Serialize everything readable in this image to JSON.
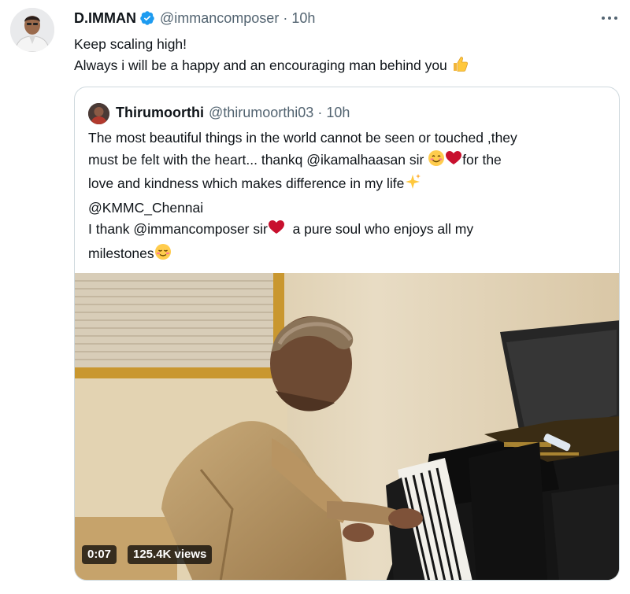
{
  "tweet": {
    "author_name": "D.IMMAN",
    "author_handle": "@immancomposer",
    "separator": "·",
    "time": "10h",
    "lines": [
      "Keep scaling high!",
      "Always i will be a happy and an encouraging man behind you"
    ],
    "icons": {
      "verified": "verified-badge-icon",
      "more": "more-options-icon",
      "thumbs_up": "thumbs-up-emoji"
    }
  },
  "quoted": {
    "author_name": "Thirumoorthi",
    "author_handle": "@thirumoorthi03",
    "separator": "·",
    "time": "10h",
    "text": {
      "l1": "The most beautiful things in the world cannot be seen or touched ,they",
      "l2a": "must be felt with the heart... thankq @ikamalhaasan sir ",
      "l2b": "for the",
      "l3": "love and kindness which makes difference in my life",
      "l4": "@KMMC_Chennai",
      "l5a": "I thank @immancomposer sir",
      "l5b": "  a pure soul who enjoys all my",
      "l6": "milestones"
    },
    "icons": {
      "smile": "smiling-face-emoji",
      "heart": "red-heart-emoji",
      "sparkles": "sparkles-emoji",
      "blush": "relieved-face-emoji"
    }
  },
  "video": {
    "duration": "0:07",
    "views": "125.4K views",
    "description": "man playing grand piano"
  },
  "colors": {
    "accent": "#1d9bf0",
    "text": "#0f1419",
    "secondary": "#536471",
    "border": "#cfd9de"
  }
}
